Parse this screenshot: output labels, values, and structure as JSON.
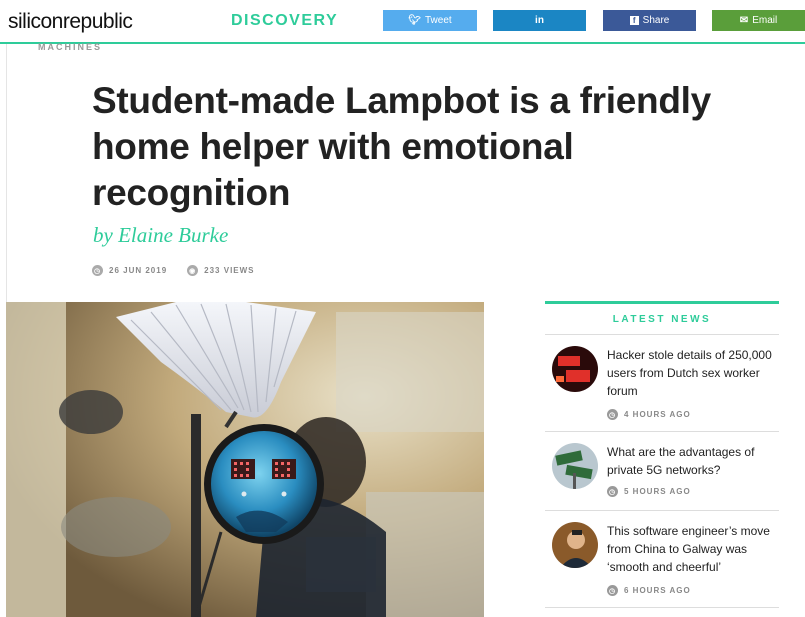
{
  "site": {
    "logo": "siliconrepublic",
    "section": "DISCOVERY",
    "accent_color": "#2ecc9a"
  },
  "share": {
    "tweet": {
      "icon": "twitter-bird-icon",
      "label": "Tweet"
    },
    "linkedin": {
      "icon": "linkedin-icon",
      "label": "in"
    },
    "facebook": {
      "icon": "facebook-icon",
      "label": "Share"
    },
    "email": {
      "icon": "envelope-icon",
      "label": "Email"
    }
  },
  "article": {
    "category": "MACHINES",
    "title": "Student-made Lampbot is a friendly home helper with emotional recognition",
    "byline": "by Elaine Burke",
    "date": "26 JUN 2019",
    "views": "233 VIEWS"
  },
  "sidebar": {
    "title": "LATEST NEWS",
    "items": [
      {
        "title": "Hacker stole details of 250,000 users from Dutch sex worker forum",
        "ago": "4 HOURS AGO"
      },
      {
        "title": "What are the advantages of private 5G networks?",
        "ago": "5 HOURS AGO"
      },
      {
        "title": "This software engineer’s move from China to Galway was ‘smooth and cheerful’",
        "ago": "6 HOURS AGO"
      }
    ]
  }
}
